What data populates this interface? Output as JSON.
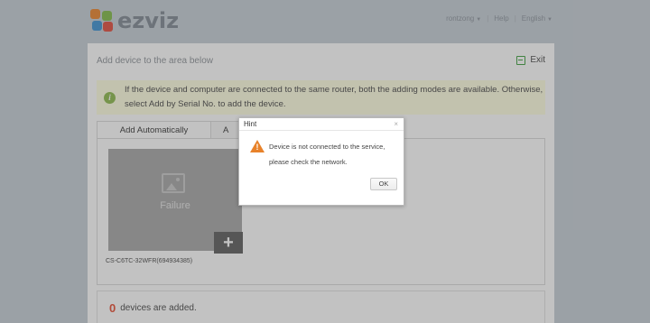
{
  "header": {
    "brand": "ezviz",
    "user_label": "rontzong",
    "help_label": "Help",
    "lang_label": "English",
    "caret_icon": "chevron-down-icon"
  },
  "panel": {
    "title": "Add device to the area below",
    "exit_label": "Exit",
    "notice": "If the device and computer are connected to the same router, both the adding modes are available. Otherwise, select Add by Serial No. to add the device.",
    "tabs": [
      {
        "label": "Add Automatically",
        "active": true
      },
      {
        "label": "A",
        "active": false
      }
    ],
    "device": {
      "status": "Failure",
      "serial": "CS-C6TC-32WFR(694934385)",
      "add_symbol": "+"
    },
    "added": {
      "count": "0",
      "text": "devices are added."
    }
  },
  "dialog": {
    "title": "Hint",
    "close_symbol": "×",
    "message_line1": "Device is not connected to the service,",
    "message_line2": "please check the network.",
    "ok_label": "OK"
  },
  "colors": {
    "accent_orange": "#e8822a",
    "count_red": "#e54a2f",
    "info_green": "#8ab84a",
    "notice_bg": "#fefde0"
  }
}
